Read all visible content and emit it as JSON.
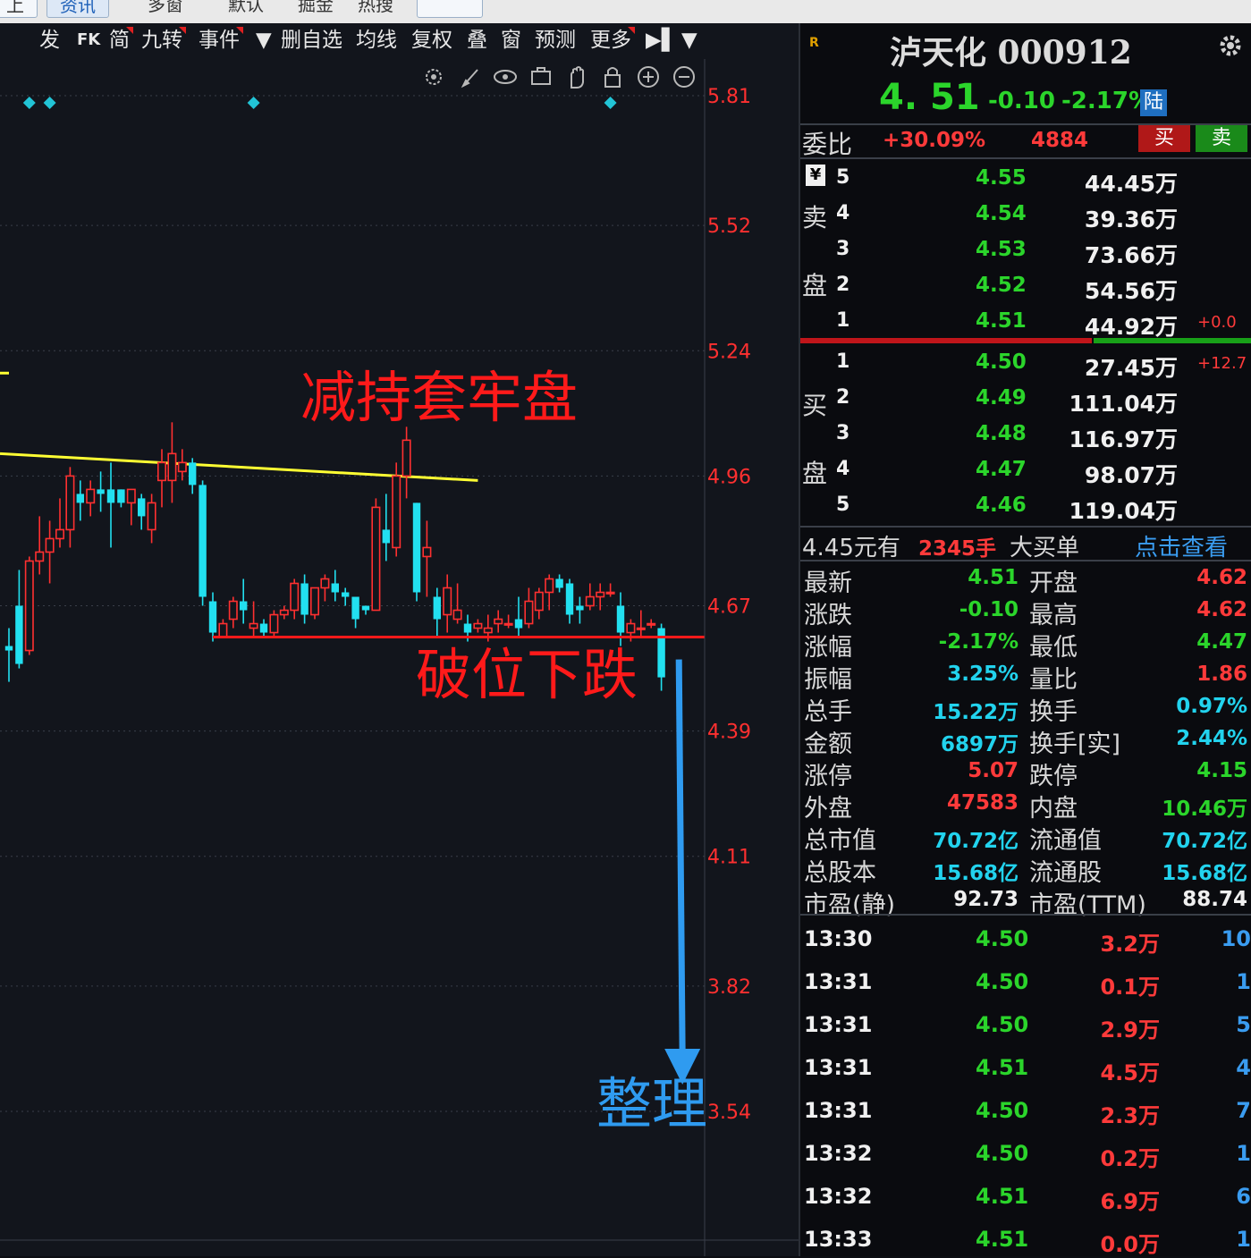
{
  "top_tabs": [
    "上",
    "资讯",
    "多窗",
    "默认",
    "掘金",
    "热搜",
    ""
  ],
  "toolbar": {
    "items": [
      {
        "label": "发",
        "marker": false
      },
      {
        "label": "FK",
        "marker": false
      },
      {
        "label": "简",
        "marker": true
      },
      {
        "label": "九转",
        "marker": true
      },
      {
        "label": "事件",
        "marker": true
      },
      {
        "label": "▼",
        "marker": false
      },
      {
        "label": "删自选",
        "marker": false
      },
      {
        "label": "均线",
        "marker": false
      },
      {
        "label": "复权",
        "marker": false
      },
      {
        "label": "叠",
        "marker": false
      },
      {
        "label": "窗",
        "marker": false
      },
      {
        "label": "预测",
        "marker": false
      },
      {
        "label": "更多",
        "marker": true
      },
      {
        "label": "▶▌",
        "marker": false
      },
      {
        "label": "▼",
        "marker": false
      }
    ],
    "tools": [
      "settings-icon",
      "pen-icon",
      "eye-icon",
      "briefcase-icon",
      "hand-icon",
      "lock-icon",
      "zoom-in-icon",
      "zoom-out-icon"
    ]
  },
  "chart_data": {
    "type": "candlestick",
    "y_axis_ticks": [
      "5.81",
      "5.52",
      "5.24",
      "4.96",
      "4.67",
      "4.39",
      "4.11",
      "3.82",
      "3.54"
    ],
    "ylim": [
      3.4,
      5.9
    ],
    "annotations": {
      "resistance_label": "减持套牢盘",
      "breakdown_label": "破位下跌",
      "target_label": "整理"
    },
    "lines": {
      "resistance": {
        "from": [
          0,
          5.01
        ],
        "to": [
          46,
          4.95
        ]
      },
      "support": {
        "from": [
          20,
          4.6
        ],
        "to": [
          64,
          4.6
        ]
      },
      "arrow": {
        "x": 63,
        "from": 4.55,
        "to": 3.62
      }
    },
    "event_markers": [
      2,
      4,
      24,
      59
    ],
    "candles": [
      {
        "o": 4.58,
        "h": 4.62,
        "l": 4.5,
        "c": 4.57
      },
      {
        "o": 4.67,
        "h": 4.75,
        "l": 4.53,
        "c": 4.54
      },
      {
        "o": 4.57,
        "h": 4.78,
        "l": 4.56,
        "c": 4.77
      },
      {
        "o": 4.77,
        "h": 4.87,
        "l": 4.74,
        "c": 4.79
      },
      {
        "o": 4.79,
        "h": 4.86,
        "l": 4.72,
        "c": 4.82
      },
      {
        "o": 4.82,
        "h": 4.91,
        "l": 4.8,
        "c": 4.84
      },
      {
        "o": 4.84,
        "h": 4.98,
        "l": 4.8,
        "c": 4.96
      },
      {
        "o": 4.92,
        "h": 4.95,
        "l": 4.86,
        "c": 4.9
      },
      {
        "o": 4.9,
        "h": 4.95,
        "l": 4.87,
        "c": 4.93
      },
      {
        "o": 4.93,
        "h": 4.97,
        "l": 4.88,
        "c": 4.92
      },
      {
        "o": 4.93,
        "h": 4.99,
        "l": 4.8,
        "c": 4.9
      },
      {
        "o": 4.93,
        "h": 4.93,
        "l": 4.89,
        "c": 4.9
      },
      {
        "o": 4.9,
        "h": 4.93,
        "l": 4.85,
        "c": 4.93
      },
      {
        "o": 4.91,
        "h": 4.92,
        "l": 4.84,
        "c": 4.87
      },
      {
        "o": 4.84,
        "h": 4.92,
        "l": 4.81,
        "c": 4.9
      },
      {
        "o": 4.95,
        "h": 5.02,
        "l": 4.89,
        "c": 4.99
      },
      {
        "o": 4.95,
        "h": 5.08,
        "l": 4.9,
        "c": 5.01
      },
      {
        "o": 4.97,
        "h": 5.02,
        "l": 4.95,
        "c": 4.99
      },
      {
        "o": 4.99,
        "h": 5.0,
        "l": 4.92,
        "c": 4.94
      },
      {
        "o": 4.94,
        "h": 4.95,
        "l": 4.67,
        "c": 4.69
      },
      {
        "o": 4.68,
        "h": 4.7,
        "l": 4.59,
        "c": 4.61
      },
      {
        "o": 4.6,
        "h": 4.64,
        "l": 4.6,
        "c": 4.63
      },
      {
        "o": 4.64,
        "h": 4.69,
        "l": 4.62,
        "c": 4.68
      },
      {
        "o": 4.68,
        "h": 4.73,
        "l": 4.63,
        "c": 4.66
      },
      {
        "o": 4.62,
        "h": 4.68,
        "l": 4.6,
        "c": 4.63
      },
      {
        "o": 4.63,
        "h": 4.64,
        "l": 4.6,
        "c": 4.61
      },
      {
        "o": 4.61,
        "h": 4.66,
        "l": 4.6,
        "c": 4.65
      },
      {
        "o": 4.65,
        "h": 4.67,
        "l": 4.64,
        "c": 4.66
      },
      {
        "o": 4.66,
        "h": 4.73,
        "l": 4.64,
        "c": 4.72
      },
      {
        "o": 4.72,
        "h": 4.74,
        "l": 4.63,
        "c": 4.65
      },
      {
        "o": 4.65,
        "h": 4.71,
        "l": 4.64,
        "c": 4.71
      },
      {
        "o": 4.71,
        "h": 4.74,
        "l": 4.68,
        "c": 4.73
      },
      {
        "o": 4.72,
        "h": 4.75,
        "l": 4.68,
        "c": 4.7
      },
      {
        "o": 4.7,
        "h": 4.71,
        "l": 4.67,
        "c": 4.69
      },
      {
        "o": 4.69,
        "h": 4.69,
        "l": 4.62,
        "c": 4.64
      },
      {
        "o": 4.67,
        "h": 4.67,
        "l": 4.65,
        "c": 4.66
      },
      {
        "o": 4.66,
        "h": 4.91,
        "l": 4.66,
        "c": 4.89
      },
      {
        "o": 4.84,
        "h": 4.92,
        "l": 4.77,
        "c": 4.81
      },
      {
        "o": 4.8,
        "h": 4.99,
        "l": 4.78,
        "c": 4.96
      },
      {
        "o": 4.96,
        "h": 5.07,
        "l": 4.91,
        "c": 5.04
      },
      {
        "o": 4.9,
        "h": 4.9,
        "l": 4.68,
        "c": 4.7
      },
      {
        "o": 4.78,
        "h": 4.86,
        "l": 4.69,
        "c": 4.8
      },
      {
        "o": 4.69,
        "h": 4.71,
        "l": 4.6,
        "c": 4.64
      },
      {
        "o": 4.65,
        "h": 4.74,
        "l": 4.61,
        "c": 4.71
      },
      {
        "o": 4.64,
        "h": 4.72,
        "l": 4.63,
        "c": 4.66
      },
      {
        "o": 4.63,
        "h": 4.65,
        "l": 4.59,
        "c": 4.61
      },
      {
        "o": 4.62,
        "h": 4.64,
        "l": 4.61,
        "c": 4.63
      },
      {
        "o": 4.61,
        "h": 4.65,
        "l": 4.59,
        "c": 4.62
      },
      {
        "o": 4.63,
        "h": 4.66,
        "l": 4.61,
        "c": 4.64
      },
      {
        "o": 4.63,
        "h": 4.65,
        "l": 4.62,
        "c": 4.63
      },
      {
        "o": 4.64,
        "h": 4.69,
        "l": 4.6,
        "c": 4.62
      },
      {
        "o": 4.63,
        "h": 4.71,
        "l": 4.62,
        "c": 4.68
      },
      {
        "o": 4.66,
        "h": 4.71,
        "l": 4.64,
        "c": 4.7
      },
      {
        "o": 4.7,
        "h": 4.74,
        "l": 4.66,
        "c": 4.73
      },
      {
        "o": 4.73,
        "h": 4.74,
        "l": 4.7,
        "c": 4.71
      },
      {
        "o": 4.72,
        "h": 4.73,
        "l": 4.63,
        "c": 4.65
      },
      {
        "o": 4.67,
        "h": 4.69,
        "l": 4.63,
        "c": 4.66
      },
      {
        "o": 4.67,
        "h": 4.72,
        "l": 4.66,
        "c": 4.69
      },
      {
        "o": 4.69,
        "h": 4.72,
        "l": 4.66,
        "c": 4.7
      },
      {
        "o": 4.7,
        "h": 4.72,
        "l": 4.69,
        "c": 4.7
      },
      {
        "o": 4.67,
        "h": 4.7,
        "l": 4.58,
        "c": 4.61
      },
      {
        "o": 4.61,
        "h": 4.64,
        "l": 4.59,
        "c": 4.63
      },
      {
        "o": 4.62,
        "h": 4.66,
        "l": 4.6,
        "c": 4.62
      },
      {
        "o": 4.63,
        "h": 4.64,
        "l": 4.62,
        "c": 4.63
      },
      {
        "o": 4.62,
        "h": 4.63,
        "l": 4.48,
        "c": 4.51
      }
    ]
  },
  "panel": {
    "stock_name": "泸天化 000912",
    "logo": "R",
    "price": "4. 51",
    "change": "-0.10",
    "change_pct": "-2.17%",
    "badge": "陆",
    "weibi_label": "委比",
    "weibi_value": "+30.09%",
    "weibi_diff": "4884",
    "buy_btn": "买",
    "sell_btn": "卖",
    "yen": "¥",
    "sell_labels": [
      "卖",
      "盘"
    ],
    "buy_labels": [
      "买",
      "盘"
    ],
    "asks": [
      {
        "level": "5",
        "price": "4.55",
        "vol": "44.45万",
        "extra": ""
      },
      {
        "level": "4",
        "price": "4.54",
        "vol": "39.36万",
        "extra": ""
      },
      {
        "level": "3",
        "price": "4.53",
        "vol": "73.66万",
        "extra": ""
      },
      {
        "level": "2",
        "price": "4.52",
        "vol": "54.56万",
        "extra": ""
      },
      {
        "level": "1",
        "price": "4.51",
        "vol": "44.92万",
        "extra": "+0.0"
      }
    ],
    "bids": [
      {
        "level": "1",
        "price": "4.50",
        "vol": "27.45万",
        "extra": "+12.7"
      },
      {
        "level": "2",
        "price": "4.49",
        "vol": "111.04万",
        "extra": ""
      },
      {
        "level": "3",
        "price": "4.48",
        "vol": "116.97万",
        "extra": ""
      },
      {
        "level": "4",
        "price": "4.47",
        "vol": "98.07万",
        "extra": ""
      },
      {
        "level": "5",
        "price": "4.46",
        "vol": "119.04万",
        "extra": ""
      }
    ],
    "bigbuy": {
      "price_text": "4.45元有",
      "amount": "2345手",
      "suffix": "大买单",
      "link": "点击查看"
    },
    "stats": [
      {
        "l1": "最新",
        "v1": "4.51",
        "c1": "green",
        "l2": "开盘",
        "v2": "4.62",
        "c2": "red"
      },
      {
        "l1": "涨跌",
        "v1": "-0.10",
        "c1": "green",
        "l2": "最高",
        "v2": "4.62",
        "c2": "red"
      },
      {
        "l1": "涨幅",
        "v1": "-2.17%",
        "c1": "green",
        "l2": "最低",
        "v2": "4.47",
        "c2": "green"
      },
      {
        "l1": "振幅",
        "v1": "3.25%",
        "c1": "cyan",
        "l2": "量比",
        "v2": "1.86",
        "c2": "red"
      },
      {
        "l1": "总手",
        "v1": "15.22万",
        "c1": "cyan",
        "l2": "换手",
        "v2": "0.97%",
        "c2": "cyan"
      },
      {
        "l1": "金额",
        "v1": "6897万",
        "c1": "cyan",
        "l2": "换手[实]",
        "v2": "2.44%",
        "c2": "cyan"
      },
      {
        "l1": "涨停",
        "v1": "5.07",
        "c1": "red",
        "l2": "跌停",
        "v2": "4.15",
        "c2": "green"
      },
      {
        "l1": "外盘",
        "v1": "47583",
        "c1": "red",
        "l2": "内盘",
        "v2": "10.46万",
        "c2": "green"
      },
      {
        "l1": "总市值",
        "v1": "70.72亿",
        "c1": "cyan",
        "l2": "流通值",
        "v2": "70.72亿",
        "c2": "cyan"
      },
      {
        "l1": "总股本",
        "v1": "15.68亿",
        "c1": "cyan",
        "l2": "流通股",
        "v2": "15.68亿",
        "c2": "cyan"
      },
      {
        "l1": "市盈(静)",
        "v1": "92.73",
        "c1": "white",
        "l2": "市盈(TTM)",
        "v2": "88.74",
        "c2": "white"
      }
    ],
    "ticks": [
      {
        "time": "13:30",
        "price": "4.50",
        "vol": "3.2万",
        "n": "10"
      },
      {
        "time": "13:31",
        "price": "4.50",
        "vol": "0.1万",
        "n": "1"
      },
      {
        "time": "13:31",
        "price": "4.50",
        "vol": "2.9万",
        "n": "5"
      },
      {
        "time": "13:31",
        "price": "4.51",
        "vol": "4.5万",
        "n": "4"
      },
      {
        "time": "13:31",
        "price": "4.50",
        "vol": "2.3万",
        "n": "7"
      },
      {
        "time": "13:32",
        "price": "4.50",
        "vol": "0.2万",
        "n": "1"
      },
      {
        "time": "13:32",
        "price": "4.51",
        "vol": "6.9万",
        "n": "6"
      },
      {
        "time": "13:33",
        "price": "4.51",
        "vol": "0.0万",
        "n": "1"
      }
    ]
  },
  "colors": {
    "up": "#ff3030",
    "down": "#22e0f0",
    "resistance_line": "#ffff33",
    "support_line": "#ff1a1a",
    "arrow": "#2f9bf0",
    "annotation_red": "#ff1a1a",
    "annotation_blue": "#2f9bf0",
    "axis_label": "#ff3030",
    "marker": "#22c4d6"
  }
}
